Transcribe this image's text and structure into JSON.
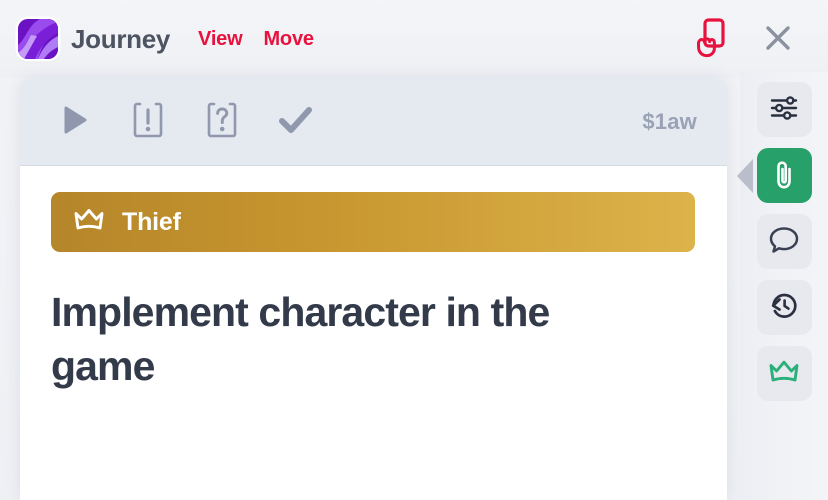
{
  "app": {
    "brand_title": "Journey",
    "logo_icon": "journey-logo-purple-swirl",
    "accent_red": "#e8123f",
    "accent_green": "#27a06a",
    "accent_gold": "#c8962f"
  },
  "menu": {
    "items": [
      {
        "label": "View",
        "name": "menu-item-view"
      },
      {
        "label": "Move",
        "name": "menu-item-move"
      }
    ]
  },
  "top_actions": {
    "items": [
      {
        "name": "grab-card-icon",
        "icon": "card-hand-grab",
        "color": "#e8123f"
      },
      {
        "name": "close-icon",
        "icon": "close-x",
        "color": "#8b929f"
      }
    ]
  },
  "card": {
    "toolbar": {
      "tools": [
        {
          "name": "play-icon",
          "icon": "play-triangle"
        },
        {
          "name": "blocker-icon",
          "icon": "card-exclamation"
        },
        {
          "name": "question-icon",
          "icon": "card-question"
        },
        {
          "name": "done-icon",
          "icon": "checkmark"
        }
      ],
      "code": "$1aw"
    },
    "type_banner": {
      "icon": "crown-icon",
      "label": "Thief"
    },
    "title": "Implement character in the game"
  },
  "rail": {
    "items": [
      {
        "name": "rail-item-settings",
        "icon": "sliders-icon",
        "active": false
      },
      {
        "name": "rail-item-attachments",
        "icon": "paperclip-icon",
        "active": true
      },
      {
        "name": "rail-item-comments",
        "icon": "speech-bubble-icon",
        "active": false
      },
      {
        "name": "rail-item-history",
        "icon": "history-rewind-icon",
        "active": false
      },
      {
        "name": "rail-item-crown",
        "icon": "crown-icon",
        "active": false
      }
    ]
  }
}
